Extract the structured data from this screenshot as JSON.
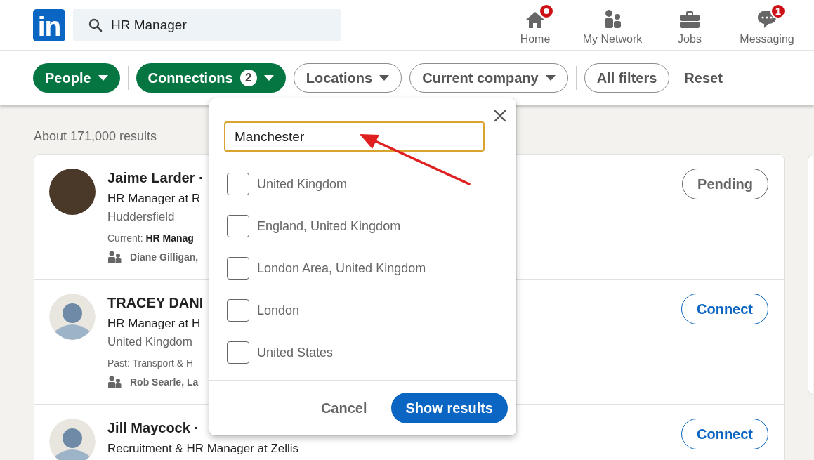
{
  "header": {
    "logo": "in",
    "search": {
      "value": "HR Manager"
    },
    "nav": [
      {
        "label": "Home",
        "notification_dot": true
      },
      {
        "label": "My Network",
        "notification_dot": false
      },
      {
        "label": "Jobs",
        "notification_dot": false
      },
      {
        "label": "Messaging",
        "notification_dot": false,
        "badge": "1"
      }
    ]
  },
  "filters": [
    {
      "kind": "pill",
      "label": "People",
      "selected": true,
      "dropdown": true
    },
    {
      "kind": "pill",
      "label": "Connections",
      "selected": true,
      "dropdown": true,
      "count": "2"
    },
    {
      "kind": "pill",
      "label": "Locations",
      "selected": false,
      "dropdown": true
    },
    {
      "kind": "pill",
      "label": "Current company",
      "selected": false,
      "dropdown": true
    },
    {
      "kind": "pill",
      "label": "All filters",
      "selected": false,
      "dropdown": false
    },
    {
      "kind": "link",
      "label": "Reset"
    }
  ],
  "results_count": "About 171,000 results",
  "results": [
    {
      "has_photo": true,
      "name": "Jaime Larder ·",
      "headline": "HR Manager at R",
      "location": "Huddersfield",
      "summary": "Current: **HR Manag**",
      "mutual": "Diane Gilligan,",
      "action": {
        "kind": "pending",
        "label": "Pending"
      }
    },
    {
      "has_photo": false,
      "name": "TRACEY DANI",
      "headline": "HR Manager at H",
      "location": "United Kingdom",
      "summary": "Past: Transport & H",
      "mutual": "Rob Searle, La",
      "action": {
        "kind": "connect",
        "label": "Connect"
      }
    },
    {
      "has_photo": false,
      "name": "Jill Maycock ·",
      "headline": "Recruitment & HR Manager at Zellis",
      "action": {
        "kind": "connect",
        "label": "Connect"
      }
    }
  ],
  "location_popup": {
    "input": {
      "value": "Manchester",
      "focused": true
    },
    "options": [
      {
        "label": "United Kingdom",
        "checked": false
      },
      {
        "label": "England, United Kingdom",
        "checked": false
      },
      {
        "label": "London Area, United Kingdom",
        "checked": false
      },
      {
        "label": "London",
        "checked": false
      },
      {
        "label": "United States",
        "checked": false
      }
    ],
    "cancel": "Cancel",
    "submit": "Show results"
  }
}
